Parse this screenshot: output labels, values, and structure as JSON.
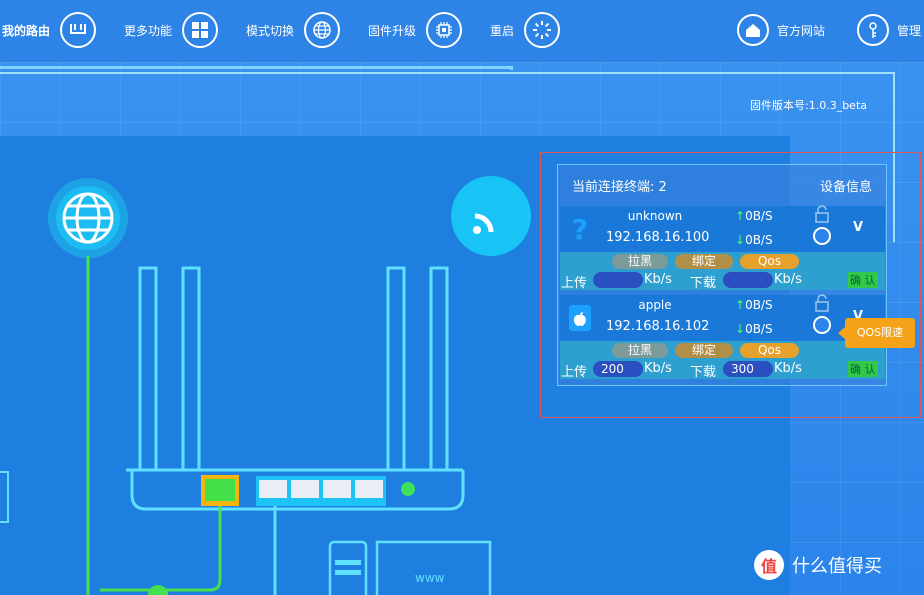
{
  "nav": {
    "items": [
      {
        "label": "我的路由",
        "icon": "router-icon"
      },
      {
        "label": "更多功能",
        "icon": "apps-grid-icon"
      },
      {
        "label": "模式切换",
        "icon": "globe-icon"
      },
      {
        "label": "固件升级",
        "icon": "chip-icon"
      },
      {
        "label": "重启",
        "icon": "reboot-icon"
      }
    ],
    "right": [
      {
        "label": "官方网站",
        "icon": "home-icon"
      },
      {
        "label": "管理",
        "icon": "key-icon"
      }
    ]
  },
  "firmware": "固件版本号:1.0.3_beta",
  "panel": {
    "title": "当前连接终端: 2",
    "info": "设备信息",
    "devices": [
      {
        "name": "unknown",
        "ip": "192.168.16.100",
        "up": "0B/S",
        "down": "0B/S",
        "icon": "question-icon",
        "v": "V",
        "buttons": {
          "block": "拉黑",
          "bind": "绑定",
          "qos": "Qos"
        },
        "upload_label": "上传",
        "upload_value": "",
        "unit": "Kb/s",
        "download_label": "下载",
        "download_value": "",
        "confirm": "确 认"
      },
      {
        "name": "apple",
        "ip": "192.168.16.102",
        "up": "0B/S",
        "down": "0B/S",
        "icon": "apple-icon",
        "v": "V",
        "buttons": {
          "block": "拉黑",
          "bind": "绑定",
          "qos": "Qos"
        },
        "upload_label": "上传",
        "upload_value": "200",
        "unit": "Kb/s",
        "download_label": "下载",
        "download_value": "300",
        "confirm": "确 认"
      }
    ]
  },
  "tooltip": "QOS限速",
  "router_label": "www",
  "watermark": {
    "badge": "值",
    "text": "什么值得买"
  }
}
